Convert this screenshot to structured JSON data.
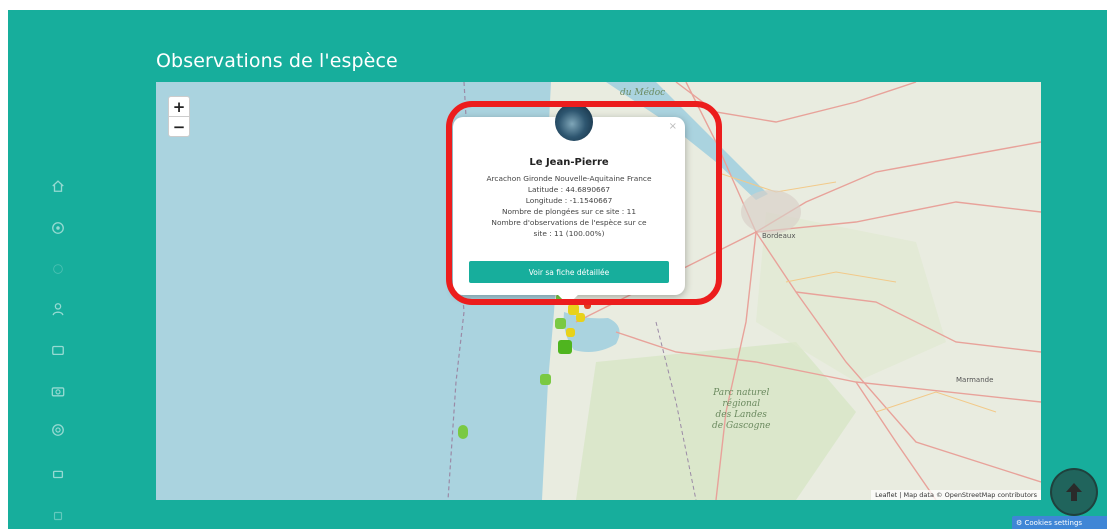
{
  "header": {
    "title": "Observations de l'espèce"
  },
  "sidebar": {
    "items": [
      {
        "icon": "home-icon"
      },
      {
        "icon": "target-icon"
      },
      {
        "icon": "blank-icon"
      },
      {
        "icon": "user-icon"
      },
      {
        "icon": "list-icon"
      },
      {
        "icon": "camera-icon"
      },
      {
        "icon": "help-icon"
      },
      {
        "icon": "settings-icon"
      },
      {
        "icon": "more-icon"
      }
    ]
  },
  "map": {
    "zoom_in_label": "+",
    "zoom_out_label": "−",
    "attribution": "Leaflet | Map data © OpenStreetMap contributors",
    "places": {
      "medoc": "du Médoc",
      "bordeaux": "Bordeaux",
      "landes": "Parc naturel\nrégional\ndes Landes\nde Gascogne",
      "marmande": "Marmande"
    }
  },
  "popup": {
    "title": "Le Jean-Pierre",
    "close_label": "×",
    "location": "Arcachon Gironde Nouvelle-Aquitaine France",
    "latitude": "Latitude : 44.6890667",
    "longitude": "Longitude : -1.1540667",
    "dives": "Nombre de plongées sur ce site : 11",
    "observations_line1": "Nombre d'observations de l'espèce sur ce",
    "observations_line2": "site : 11 (100.00%)",
    "button_label": "Voir sa fiche détaillée"
  },
  "cookie": {
    "label": "⚙ Cookies settings"
  },
  "colors": {
    "brand": "#17ae9c",
    "highlight": "#ec1d1d",
    "marker_yellow": "#e8d21a",
    "marker_green": "#7ac943",
    "marker_red": "#e23a1c"
  }
}
